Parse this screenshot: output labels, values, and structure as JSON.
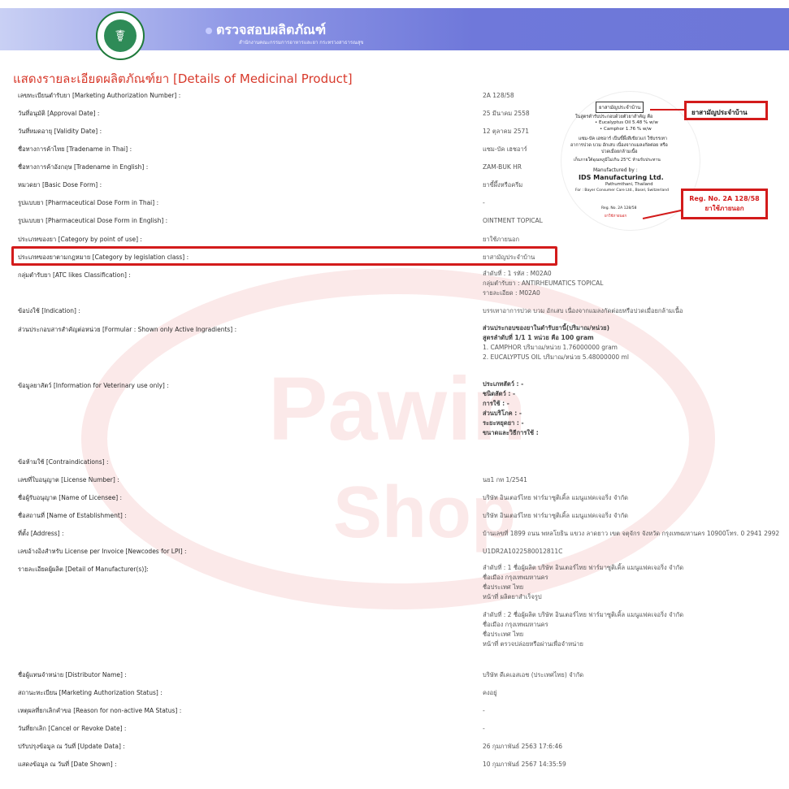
{
  "header": {
    "site_title": "ตรวจสอบผลิตภัณฑ์",
    "site_subtitle": "สำนักงานคณะกรรมการอาหารและยา กระทรวงสาธารณสุข",
    "logo_icon": "fda-emblem-icon"
  },
  "page_title": "แสดงรายละเอียดผลิตภัณฑ์ยา [Details of Medicinal Product]",
  "fields": [
    {
      "label": "เลขทะเบียนตำรับยา [Marketing Authorization Number] :",
      "value": [
        "2A 128/58"
      ]
    },
    {
      "label": "วันที่อนุมัติ [Approval Date] :",
      "value": [
        "25 มีนาคม 2558"
      ]
    },
    {
      "label": "วันที่หมดอายุ [Validity Date] :",
      "value": [
        "12 ตุลาคม 2571"
      ]
    },
    {
      "label": "ชื่อทางการค้าไทย [Tradename in Thai] :",
      "value": [
        "แซม-บัค เฮชอาร์"
      ]
    },
    {
      "label": "ชื่อทางการค้าอังกฤษ [Tradename in English] :",
      "value": [
        "ZAM-BUK HR"
      ]
    },
    {
      "label": "หมวดยา [Basic Dose Form] :",
      "value": [
        "ยาขี้ผึ้งหรือครีม"
      ]
    },
    {
      "label": "รูปแบบยา [Pharmaceutical Dose Form in Thai] :",
      "value": [
        "-"
      ]
    },
    {
      "label": "รูปแบบยา [Pharmaceutical Dose Form in English] :",
      "value": [
        "OINTMENT TOPICAL"
      ]
    },
    {
      "label": "ประเภทของยา [Category by point of use] :",
      "value": [
        "ยาใช้ภายนอก"
      ]
    },
    {
      "label": "ประเภทของยาตามกฎหมาย [Category by legislation class] :",
      "value": [
        "ยาสามัญประจำบ้าน"
      ]
    },
    {
      "label": "กลุ่มตำรับยา [ATC likes Classification] :",
      "value": [
        "ลำดับที่ : 1 รหัส : M02A0",
        "กลุ่มตำรับยา : ANTIRHEUMATICS TOPICAL",
        "รายละเอียด : M02A0"
      ]
    },
    {
      "label": "ข้อบ่งใช้ [Indication] :",
      "value": [
        "บรรเทาอาการปวด บวม อักเสบ เนื่องจากแมลงกัดต่อยหรือปวดเมื่อยกล้ามเนื้อ"
      ]
    },
    {
      "label": "ส่วนประกอบสารสำคัญต่อหน่วย [Formular : Shown only Active Ingradients] :",
      "value": [
        "ส่วนประกอบของยาในตำรับยานี้(ปริมาณ/หน่วย)",
        "สูตรลำดับที่ 1/1 1 หน่วย คือ 100 gram",
        "1. CAMPHOR      ปริมาณ/หน่วย  1.76000000 gram",
        "2. EUCALYPTUS OIL      ปริมาณ/หน่วย  5.48000000 ml"
      ]
    },
    {
      "label": "ข้อมูลยาสัตว์ [Information for Veterinary use only] :",
      "value": [
        "ประเภทสัตว์ : -",
        "ชนิดสัตว์ : -",
        "การใช้ : -",
        "ส่วนบริโภค : -",
        "ระยะหยุดยา : -",
        "ขนาดและวิธีการใช้ :"
      ]
    },
    {
      "label": "ข้อห้ามใช้ [Contraindications] :",
      "value": []
    },
    {
      "label": "เลขที่ใบอนุญาต [License Number] :",
      "value": [
        "นย1 กท 1/2541"
      ]
    },
    {
      "label": "ชื่อผู้รับอนุญาต [Name of Licensee] :",
      "value": [
        "บริษัท อินเตอร์ไทย ฟาร์มาซูติเคิ้ล แมนูแฟคเจอริ่ง จำกัด"
      ]
    },
    {
      "label": "ชื่อสถานที่ [Name of Establishment] :",
      "value": [
        "บริษัท อินเตอร์ไทย ฟาร์มาซูติเคิ้ล แมนูแฟคเจอริ่ง จำกัด"
      ]
    },
    {
      "label": "ที่ตั้ง [Address] :",
      "value": [
        "บ้านเลขที่ 1899 ถนน พหลโยธิน แขวง ลาดยาว เขต จตุจักร จังหวัด กรุงเทพมหานคร 10900โทร. 0 2941 2992"
      ]
    },
    {
      "label": "เลขอ้างอิงสำหรับ License per Invoice [Newcodes for LPI] :",
      "value": [
        "U1DR2A1022580012811C"
      ]
    },
    {
      "label": "รายละเอียดผู้ผลิต [Detail of Manufacturer(s)]:",
      "value": [
        "ลำดับที่ : 1 ชื่อผู้ผลิต บริษัท อินเตอร์ไทย ฟาร์มาซูติเคิ้ล แมนูแฟคเจอริ่ง จำกัด",
        "ชื่อเมือง กรุงเทพมหานคร",
        "ชื่อประเทศ ไทย",
        "หน้าที่ ผลิตยาสำเร็จรูป",
        "",
        "ลำดับที่ : 2 ชื่อผู้ผลิต บริษัท อินเตอร์ไทย ฟาร์มาซูติเคิ้ล แมนูแฟคเจอริ่ง จำกัด",
        "ชื่อเมือง กรุงเทพมหานคร",
        "ชื่อประเทศ ไทย",
        "หน้าที่ ตรวจปล่อยหรือผ่านเพื่อจำหน่าย"
      ]
    },
    {
      "label": "ชื่อผู้แทนจำหน่าย [Distributor Name] :",
      "value": [
        "บริษัท ดีเคเอสเอช (ประเทศไทย) จำกัด"
      ]
    },
    {
      "label": "สถานะทะเบียน [Marketing Authorization Status] :",
      "value": [
        "คงอยู่"
      ]
    },
    {
      "label": "เหตุผลที่ยกเลิกคำขอ [Reason for non-active MA Status] :",
      "value": [
        "-"
      ]
    },
    {
      "label": "วันที่ยกเลิก [Cancel or Revoke Date] :",
      "value": [
        "-"
      ]
    },
    {
      "label": "ปรับปรุงข้อมูล ณ วันที่ [Update Data] :",
      "value": [
        "26 กุมภาพันธ์ 2563 17:6:46"
      ]
    },
    {
      "label": "แสดงข้อมูล ณ วันที่ [Date Shown] :",
      "value": [
        "10 กุมภาพันธ์ 2567 14:35:59"
      ]
    }
  ],
  "package_image": {
    "tag": "ยาสามัญประจำบ้าน",
    "lines": [
      "ในสูตรตำรับประกอบด้วยตัวยาสำคัญ คือ",
      "• Eucalyptus Oil 5.48 % w/w",
      "• Camphor 1.76 % w/w",
      "แซม-บัค เฮชอาร์ เป็นขี้ผึ้งสีเขียวแก่ ใช้บรรเทา",
      "อาการปวด บวม อักเสบ เนื่องจากแมลงกัดต่อย หรือ",
      "ปวดเมื่อยกล้ามเนื้อ",
      "เก็บภายใต้อุณหภูมิไม่เกิน 25°C ห้ามรับประทาน",
      "Manufactured by :",
      "IDS Manufacturing Ltd.",
      "Pathumthani, Thailand",
      "For : Bayer Consumer Care Ltd., Basel, Switzerland",
      "Reg. No. 2A 128/58",
      "ยาใช้ภายนอก"
    ],
    "callout_top": "ยาสามัญประจำบ้าน",
    "callout_reg": "Reg. No. 2A 128/58",
    "callout_ext": "ยาใช้ภายนอก"
  },
  "watermark": {
    "word1": "Pawin",
    "word2": "Shop"
  }
}
